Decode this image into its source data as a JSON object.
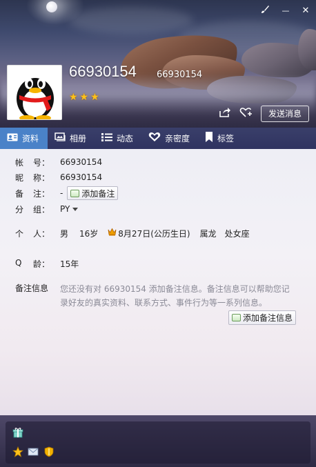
{
  "window": {
    "skin_icon": "paintbrush-icon",
    "minimize_icon": "minimize-icon",
    "close_icon": "close-icon",
    "minimize_glyph": "—",
    "close_glyph": "✕"
  },
  "profile": {
    "nickname": "66930154",
    "account_small": "66930154",
    "stars": "★★★",
    "share_icon": "share-icon",
    "add_friend_icon": "heart-plus-icon",
    "send_message": "发送消息"
  },
  "tabs": [
    {
      "label": "资料",
      "icon": "profile-card-icon",
      "active": true
    },
    {
      "label": "相册",
      "icon": "photo-album-icon",
      "active": false
    },
    {
      "label": "动态",
      "icon": "list-icon",
      "active": false
    },
    {
      "label": "亲密度",
      "icon": "heart-icon",
      "active": false
    },
    {
      "label": "标签",
      "icon": "bookmark-icon",
      "active": false
    }
  ],
  "info": {
    "account_label_1": "帐",
    "account_label_2": "号：",
    "account_value": "66930154",
    "nickname_label_1": "昵",
    "nickname_label_2": "称：",
    "nickname_value": "66930154",
    "remark_label_1": "备",
    "remark_label_2": "注：",
    "remark_value": "-",
    "add_remark": "添加备注",
    "group_label_1": "分",
    "group_label_2": "组：",
    "group_value": "PY",
    "personal_label_1": "个",
    "personal_label_2": "人：",
    "gender": "男",
    "age": "16岁",
    "birthday": "8月27日(公历生日)",
    "zodiac": "属龙",
    "constellation": "处女座",
    "qage_label_1": "Q",
    "qage_label_2": "龄：",
    "qage_value": "15年",
    "note_label": "备注信息",
    "note_text": "您还没有对 66930154 添加备注信息。备注信息可以帮助您记录好友的真实资料、联系方式、事件行为等一系列信息。",
    "add_note_info": "添加备注信息"
  },
  "footer": {
    "icons": [
      "gift-icon",
      "star-icon",
      "mail-icon",
      "shield-icon"
    ]
  }
}
